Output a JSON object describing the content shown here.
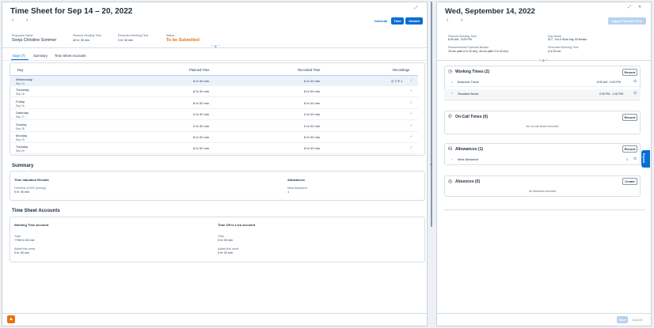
{
  "left": {
    "title": "Time Sheet for Sep 14 – 20, 2022",
    "nav_prev": "‹",
    "nav_next": "›",
    "header_actions": {
      "calendar": "Calendar",
      "time": "Time",
      "submit": "Submit"
    },
    "info": {
      "employee_label": "Employee Name",
      "employee_value": "Sonja Christine Sommer",
      "planned_label": "Planned Working Time",
      "planned_value": "40 hr 30 min",
      "recorded_label": "Recorded Working Time",
      "recorded_value": "0 hr 30 min",
      "status_label": "Status",
      "status_value": "To be Submitted"
    },
    "tabs": [
      "Days (7)",
      "Summary",
      "Time Sheet Accounts"
    ],
    "table": {
      "headers": {
        "day": "Day",
        "planned": "Planned Time",
        "recorded": "Recorded Time",
        "recordings": "Recordings"
      },
      "rows": [
        {
          "day": "Wednesday",
          "date": "Sep 14",
          "planned": "8 hr 00 min",
          "recorded": "8 hr 00 min",
          "recordings": "◷ 2  ⚲ 1"
        },
        {
          "day": "Thursday",
          "date": "Sep 15",
          "planned": "8 hr 00 min",
          "recorded": "8 hr 00 min",
          "recordings": ""
        },
        {
          "day": "Friday",
          "date": "Sep 16",
          "planned": "8 hr 00 min",
          "recorded": "8 hr 00 min",
          "recordings": ""
        },
        {
          "day": "Saturday",
          "date": "Sep 17",
          "planned": "0 hr 00 min",
          "recorded": "0 hr 00 min",
          "recordings": ""
        },
        {
          "day": "Sunday",
          "date": "Sep 18",
          "planned": "0 hr 00 min",
          "recorded": "0 hr 00 min",
          "recordings": ""
        },
        {
          "day": "Monday",
          "date": "Sep 19",
          "planned": "8 hr 00 min",
          "recorded": "8 hr 00 min",
          "recordings": ""
        },
        {
          "day": "Tuesday",
          "date": "Sep 20",
          "planned": "8 hr 00 min",
          "recorded": "8 hr 00 min",
          "recordings": ""
        }
      ]
    },
    "summary": {
      "section_title": "Summary",
      "time_valuation": "Time Valuation Results",
      "overtime_label": "Overtime (100% (hourly))",
      "overtime_value": "0 hr 30 min",
      "allowances": "Allowances",
      "allowance_label": "Meal Allowance",
      "allowance_value": "1"
    },
    "accounts": {
      "section_title": "Time Sheet Accounts",
      "wta_title": "Working Time Account",
      "toil_title": "Time Off in Lieu Account",
      "total_label": "Total",
      "wta_total": "+798 hr 15 min",
      "toil_total": "0 hr 00 min",
      "added_label": "Added this week",
      "wta_added": "0 hr 30 min",
      "toil_added": "0 hr 00 min"
    }
  },
  "right": {
    "title": "Wed, September 14, 2022",
    "apply_button": "Apply Planned Time",
    "info": {
      "planned_label": "Planned Working Time",
      "planned_value": "8:00 AM - 5:00 PM",
      "daymodel_label": "Day Model",
      "daymodel_value": "DLT - 8 to 5 Work Day, 60 Breaks",
      "breaks_label": "Recommended Optional Breaks",
      "breaks_value": "30 min (after 6 hr 00 min), 45 min (after 9 hr 00 min)",
      "recorded_label": "Recorded Working Time",
      "recorded_value": "8 hr 00 min"
    },
    "working_times": {
      "title": "Working Times (2)",
      "record": "Record",
      "items": [
        {
          "name": "Business Travel",
          "time": "8:00 AM - 5:00 PM"
        },
        {
          "name": "Standard Break",
          "time": "2:00 PM - 2:30 PM"
        }
      ]
    },
    "oncall": {
      "title": "On-Call Times (0)",
      "record": "Record",
      "empty": "No on-call times recorded"
    },
    "allowances": {
      "title": "Allowances (1)",
      "record": "Record",
      "item": "Meal Allowance",
      "count": "1"
    },
    "absences": {
      "title": "Absences (0)",
      "create": "Create",
      "empty": "No absences recorded"
    },
    "footer": {
      "save": "Save",
      "cancel": "Cancel"
    },
    "side_tab": "Expand"
  },
  "colors": {
    "accent": "#0a6ed1",
    "status": "#e9730c"
  }
}
